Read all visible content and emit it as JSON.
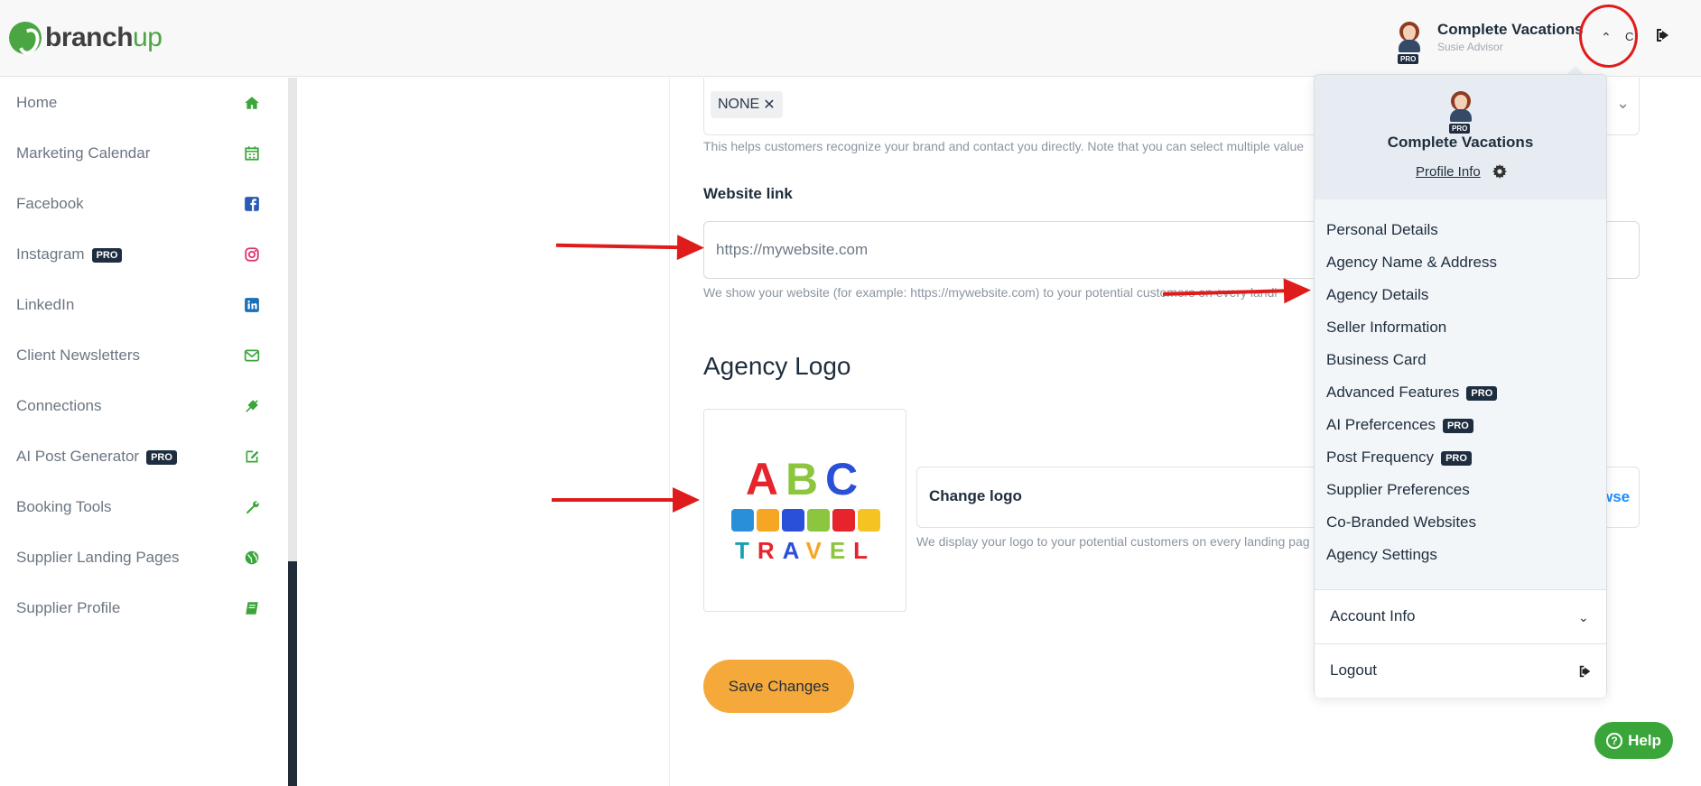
{
  "header": {
    "logo_text_a": "branch",
    "logo_text_b": "up",
    "account_name": "Complete Vacations",
    "account_role": "Susie Advisor",
    "avatar_badge": "PRO",
    "collapsed_letter": "C"
  },
  "sidebar": {
    "items": [
      {
        "label": "Home",
        "icon": "home-icon",
        "pro": ""
      },
      {
        "label": "Marketing Calendar",
        "icon": "calendar-icon",
        "pro": ""
      },
      {
        "label": "Facebook",
        "icon": "facebook-icon",
        "pro": ""
      },
      {
        "label": "Instagram",
        "icon": "instagram-icon",
        "pro": "PRO"
      },
      {
        "label": "LinkedIn",
        "icon": "linkedin-icon",
        "pro": ""
      },
      {
        "label": "Client Newsletters",
        "icon": "envelope-icon",
        "pro": ""
      },
      {
        "label": "Connections",
        "icon": "plug-icon",
        "pro": ""
      },
      {
        "label": "AI Post Generator",
        "icon": "edit-icon",
        "pro": "PRO"
      },
      {
        "label": "Booking Tools",
        "icon": "wrench-icon",
        "pro": ""
      },
      {
        "label": "Supplier Landing Pages",
        "icon": "globe-icon",
        "pro": ""
      },
      {
        "label": "Supplier Profile",
        "icon": "book-icon",
        "pro": ""
      }
    ]
  },
  "form": {
    "tag_value": "NONE",
    "tag_help": "This helps customers recognize your brand and contact you directly. Note that you can select multiple value",
    "website_label": "Website link",
    "website_placeholder": "https://mywebsite.com",
    "website_help": "We show your website (for example: https://mywebsite.com) to your potential cust",
    "website_help_tail": "omers on every landi",
    "logo_section_title": "Agency Logo",
    "logo_image_text": "ABC",
    "logo_image_text2": "TRAVEL",
    "change_logo_label": "Change logo",
    "browse_label": "wse",
    "logo_help": "We display your logo to your potential customers on every landing pag",
    "save_label": "Save Changes"
  },
  "menu": {
    "name": "Complete Vacations",
    "badge": "PRO",
    "profile_link": "Profile Info",
    "items": [
      {
        "label": "Personal Details",
        "pro": ""
      },
      {
        "label": "Agency Name & Address",
        "pro": ""
      },
      {
        "label": "Agency Details",
        "pro": ""
      },
      {
        "label": "Seller Information",
        "pro": ""
      },
      {
        "label": "Business Card",
        "pro": ""
      },
      {
        "label": "Advanced Features",
        "pro": "PRO"
      },
      {
        "label": "AI Prefercences",
        "pro": "PRO"
      },
      {
        "label": "Post Frequency",
        "pro": "PRO"
      },
      {
        "label": "Supplier Preferences",
        "pro": ""
      },
      {
        "label": "Co-Branded Websites",
        "pro": ""
      },
      {
        "label": "Agency Settings",
        "pro": ""
      }
    ],
    "account_info": "Account Info",
    "logout": "Logout"
  },
  "help_button": "Help",
  "colors": {
    "brand_green": "#4ca543",
    "accent_orange": "#f5a93b",
    "annotation_red": "#e01b1b",
    "pro_badge": "#1e2d40"
  }
}
